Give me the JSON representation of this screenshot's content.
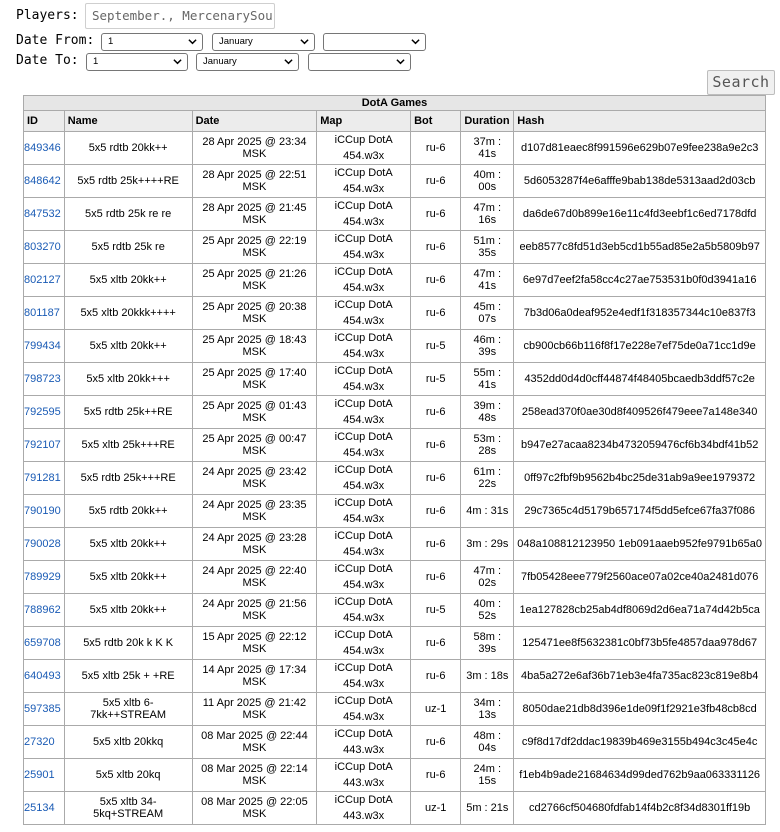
{
  "filters": {
    "players_label": "Players:",
    "players_value": "September., MercenarySou",
    "date_from_label": "Date From:",
    "date_to_label": "Date To:",
    "from_day": "1",
    "from_month": "January",
    "from_year": "",
    "to_day": "1",
    "to_month": "January",
    "to_year": "",
    "search_label": "Search"
  },
  "table": {
    "title": "DotA Games",
    "headers": [
      "ID",
      "Name",
      "Date",
      "Map",
      "Bot",
      "Duration",
      "Hash"
    ],
    "rows": [
      {
        "id": "849346",
        "name": "5x5 rdtb 20kk++",
        "date": "28 Apr 2025 @ 23:34 MSK",
        "map1": "iCCup DotA",
        "map2": "454.w3x",
        "bot": "ru-6",
        "duration": "37m : 41s",
        "hash": "d107d81eaec8f991596e629b07e9fee238a9e2c3"
      },
      {
        "id": "848642",
        "name": "5x5 rdtb 25k++++RE",
        "date": "28 Apr 2025 @ 22:51 MSK",
        "map1": "iCCup DotA",
        "map2": "454.w3x",
        "bot": "ru-6",
        "duration": "40m : 00s",
        "hash": "5d6053287f4e6afffe9bab138de5313aad2d03cb"
      },
      {
        "id": "847532",
        "name": "5x5 rdtb 25k re re",
        "date": "28 Apr 2025 @ 21:45 MSK",
        "map1": "iCCup DotA",
        "map2": "454.w3x",
        "bot": "ru-6",
        "duration": "47m : 16s",
        "hash": "da6de67d0b899e16e11c4fd3eebf1c6ed7178dfd"
      },
      {
        "id": "803270",
        "name": "5x5 rdtb 25k re",
        "date": "25 Apr 2025 @ 22:19 MSK",
        "map1": "iCCup DotA",
        "map2": "454.w3x",
        "bot": "ru-6",
        "duration": "51m : 35s",
        "hash": "eeb8577c8fd51d3eb5cd1b55ad85e2a5b5809b97"
      },
      {
        "id": "802127",
        "name": "5x5 xltb 20kk++",
        "date": "25 Apr 2025 @ 21:26 MSK",
        "map1": "iCCup DotA",
        "map2": "454.w3x",
        "bot": "ru-6",
        "duration": "47m : 41s",
        "hash": "6e97d7eef2fa58cc4c27ae753531b0f0d3941a16"
      },
      {
        "id": "801187",
        "name": "5x5 xltb 20kkk++++",
        "date": "25 Apr 2025 @ 20:38 MSK",
        "map1": "iCCup DotA",
        "map2": "454.w3x",
        "bot": "ru-6",
        "duration": "45m : 07s",
        "hash": "7b3d06a0deaf952e4edf1f318357344c10e837f3"
      },
      {
        "id": "799434",
        "name": "5x5 xltb 20kk++",
        "date": "25 Apr 2025 @ 18:43 MSK",
        "map1": "iCCup DotA",
        "map2": "454.w3x",
        "bot": "ru-5",
        "duration": "46m : 39s",
        "hash": "cb900cb66b116f8f17e228e7ef75de0a71cc1d9e"
      },
      {
        "id": "798723",
        "name": "5x5 xltb 20kk+++",
        "date": "25 Apr 2025 @ 17:40 MSK",
        "map1": "iCCup DotA",
        "map2": "454.w3x",
        "bot": "ru-5",
        "duration": "55m : 41s",
        "hash": "4352dd0d4d0cff44874f48405bcaedb3ddf57c2e"
      },
      {
        "id": "792595",
        "name": "5x5 rdtb 25k++RE",
        "date": "25 Apr 2025 @ 01:43 MSK",
        "map1": "iCCup DotA",
        "map2": "454.w3x",
        "bot": "ru-6",
        "duration": "39m : 48s",
        "hash": "258ead370f0ae30d8f409526f479eee7a148e340"
      },
      {
        "id": "792107",
        "name": "5x5 xltb 25k+++RE",
        "date": "25 Apr 2025 @ 00:47 MSK",
        "map1": "iCCup DotA",
        "map2": "454.w3x",
        "bot": "ru-6",
        "duration": "53m : 28s",
        "hash": "b947e27acaa8234b4732059476cf6b34bdf41b52"
      },
      {
        "id": "791281",
        "name": "5x5 rdtb 25k+++RE",
        "date": "24 Apr 2025 @ 23:42 MSK",
        "map1": "iCCup DotA",
        "map2": "454.w3x",
        "bot": "ru-6",
        "duration": "61m : 22s",
        "hash": "0ff97c2fbf9b9562b4bc25de31ab9a9ee1979372"
      },
      {
        "id": "790190",
        "name": "5x5 rdtb 20kk++",
        "date": "24 Apr 2025 @ 23:35 MSK",
        "map1": "iCCup DotA",
        "map2": "454.w3x",
        "bot": "ru-6",
        "duration": "4m : 31s",
        "hash": "29c7365c4d5179b657174f5dd5efce67fa37f086"
      },
      {
        "id": "790028",
        "name": "5x5 xltb 20kk++",
        "date": "24 Apr 2025 @ 23:28 MSK",
        "map1": "iCCup DotA",
        "map2": "454.w3x",
        "bot": "ru-6",
        "duration": "3m : 29s",
        "hash": "048a108812123950 1eb091aaeb952fe9791b65a0"
      },
      {
        "id": "789929",
        "name": "5x5 xltb 20kk++",
        "date": "24 Apr 2025 @ 22:40 MSK",
        "map1": "iCCup DotA",
        "map2": "454.w3x",
        "bot": "ru-6",
        "duration": "47m : 02s",
        "hash": "7fb05428eee779f2560ace07a02ce40a2481d076"
      },
      {
        "id": "788962",
        "name": "5x5 xltb 20kk++",
        "date": "24 Apr 2025 @ 21:56 MSK",
        "map1": "iCCup DotA",
        "map2": "454.w3x",
        "bot": "ru-5",
        "duration": "40m : 52s",
        "hash": "1ea127828cb25ab4df8069d2d6ea71a74d42b5ca"
      },
      {
        "id": "659708",
        "name": "5x5 rdtb 20k k K K",
        "date": "15 Apr 2025 @ 22:12 MSK",
        "map1": "iCCup DotA",
        "map2": "454.w3x",
        "bot": "ru-6",
        "duration": "58m : 39s",
        "hash": "125471ee8f5632381c0bf73b5fe4857daa978d67"
      },
      {
        "id": "640493",
        "name": "5x5 xltb 25k + +RE",
        "date": "14 Apr 2025 @ 17:34 MSK",
        "map1": "iCCup DotA",
        "map2": "454.w3x",
        "bot": "ru-6",
        "duration": "3m : 18s",
        "hash": "4ba5a272e6af36b71eb3e4fa735ac823c819e8b4"
      },
      {
        "id": "597385",
        "name": "5x5 xltb 6-7kk++STREAM",
        "date": "11 Apr 2025 @ 21:42 MSK",
        "map1": "iCCup DotA",
        "map2": "454.w3x",
        "bot": "uz-1",
        "duration": "34m : 13s",
        "hash": "8050dae21db8d396e1de09f1f2921e3fb48cb8cd"
      },
      {
        "id": "27320",
        "name": "5x5 xltb 20kkq",
        "date": "08 Mar 2025 @ 22:44 MSK",
        "map1": "iCCup DotA",
        "map2": "443.w3x",
        "bot": "ru-6",
        "duration": "48m : 04s",
        "hash": "c9f8d17df2ddac19839b469e3155b494c3c45e4c"
      },
      {
        "id": "25901",
        "name": "5x5 xltb 20kq",
        "date": "08 Mar 2025 @ 22:14 MSK",
        "map1": "iCCup DotA",
        "map2": "443.w3x",
        "bot": "ru-6",
        "duration": "24m : 15s",
        "hash": "f1eb4b9ade21684634d99ded762b9aa063331126"
      },
      {
        "id": "25134",
        "name": "5x5 xltb 34-5kq+STREAM",
        "date": "08 Mar 2025 @ 22:05 MSK",
        "map1": "iCCup DotA",
        "map2": "443.w3x",
        "bot": "uz-1",
        "duration": "5m : 21s",
        "hash": "cd2766cf504680fdfab14f4b2c8f34d8301ff19b"
      }
    ]
  },
  "colors": {
    "link": "#1a5bb5",
    "header_bg": "#ececec"
  },
  "icons": {
    "select_chevron": "chevron-down-icon"
  }
}
